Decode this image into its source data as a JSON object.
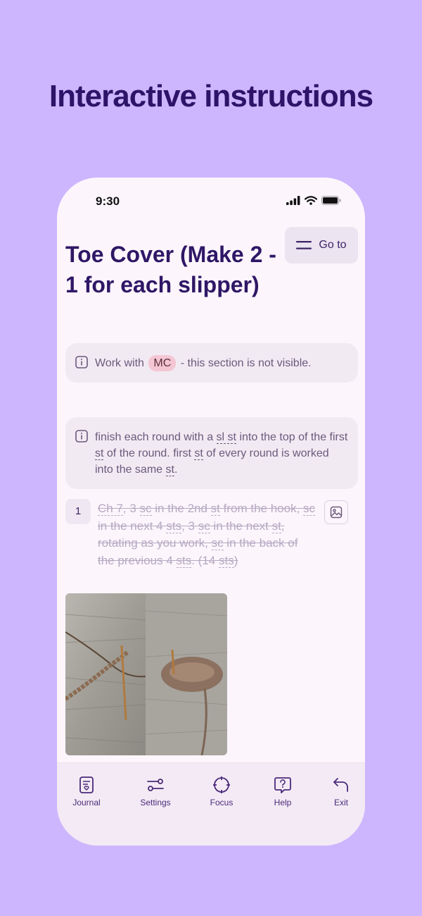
{
  "headline": "Interactive instructions",
  "status_bar": {
    "time": "9:30"
  },
  "goto_button": {
    "label": "Go to"
  },
  "section_title": "Toe Cover (Make 2 - 1 for each slipper)",
  "notes": [
    {
      "before": "Work with",
      "chip": "MC",
      "after": "- this section is not visible."
    },
    {
      "p1": "finish each round with a ",
      "t1": "sl st",
      "p2": " into the top of the first ",
      "t2": "st",
      "p3": " of the round. first ",
      "t3": "st",
      "p4": " of every round is worked into the same ",
      "t4": "st",
      "p5": "."
    }
  ],
  "step": {
    "number": "1",
    "s1": "Ch 7",
    "s2": ", 3 ",
    "s3": "sc",
    "s4": " in the 2nd ",
    "s5": "st",
    "s6": " from the hook, ",
    "s7": "sc",
    "s8": " in the next 4 ",
    "s9": "sts",
    "s10": ", 3 ",
    "s11": "sc",
    "s12": " in the next ",
    "s13": "st",
    "s14": ", rotating as you work, ",
    "s15": "sc",
    "s16": " in the back of the previous 4 ",
    "s17": "sts",
    "s18": ". (14 ",
    "s19": "sts",
    "s20": ")"
  },
  "tabs": [
    {
      "label": "Journal",
      "icon": "journal-icon"
    },
    {
      "label": "Settings",
      "icon": "settings-icon"
    },
    {
      "label": "Focus",
      "icon": "focus-icon"
    },
    {
      "label": "Help",
      "icon": "help-icon"
    },
    {
      "label": "Exit",
      "icon": "exit-icon"
    }
  ],
  "colors": {
    "background": "#cdb6fe",
    "headline": "#2e1368",
    "title": "#2f1766",
    "chip": "#f4c6d3"
  }
}
